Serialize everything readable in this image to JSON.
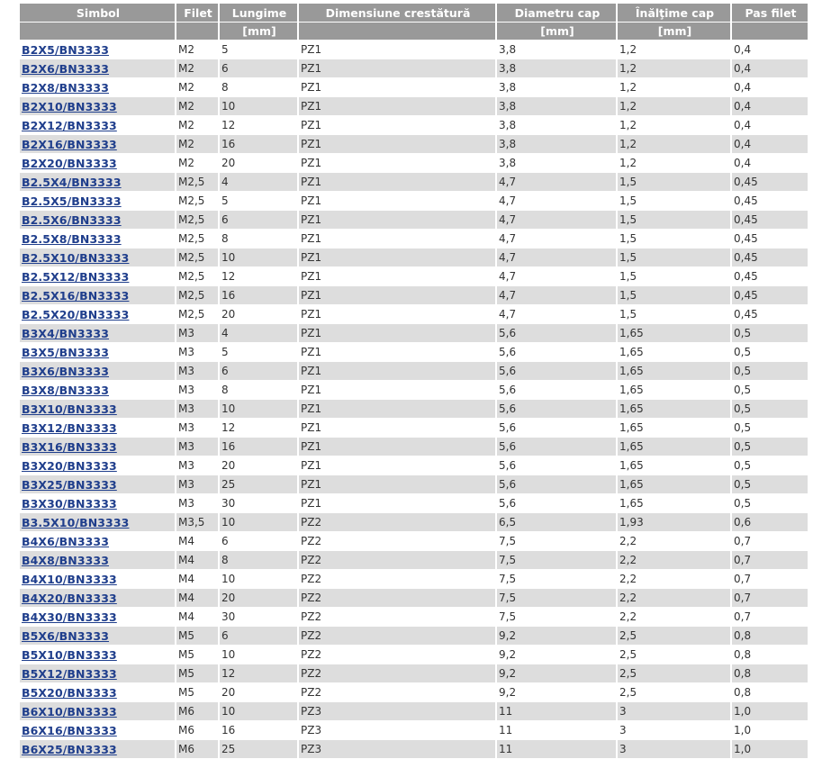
{
  "headers": {
    "simbol": "Simbol",
    "filet": "Filet",
    "lungime": "Lungime",
    "dimensiune": "Dimensiune crestătură",
    "diametru": "Diametru cap",
    "inaltime": "Înălţime cap",
    "pas": "Pas filet"
  },
  "units": {
    "simbol": "",
    "filet": "",
    "lungime": "[mm]",
    "dimensiune": "",
    "diametru": "[mm]",
    "inaltime": "[mm]",
    "pas": ""
  },
  "rows": [
    {
      "simbol": "B2X5/BN3333",
      "filet": "M2",
      "lungime": "5",
      "dimensiune": "PZ1",
      "diametru": "3,8",
      "inaltime": "1,2",
      "pas": "0,4"
    },
    {
      "simbol": "B2X6/BN3333",
      "filet": "M2",
      "lungime": "6",
      "dimensiune": "PZ1",
      "diametru": "3,8",
      "inaltime": "1,2",
      "pas": "0,4"
    },
    {
      "simbol": "B2X8/BN3333",
      "filet": "M2",
      "lungime": "8",
      "dimensiune": "PZ1",
      "diametru": "3,8",
      "inaltime": "1,2",
      "pas": "0,4"
    },
    {
      "simbol": "B2X10/BN3333",
      "filet": "M2",
      "lungime": "10",
      "dimensiune": "PZ1",
      "diametru": "3,8",
      "inaltime": "1,2",
      "pas": "0,4"
    },
    {
      "simbol": "B2X12/BN3333",
      "filet": "M2",
      "lungime": "12",
      "dimensiune": "PZ1",
      "diametru": "3,8",
      "inaltime": "1,2",
      "pas": "0,4"
    },
    {
      "simbol": "B2X16/BN3333",
      "filet": "M2",
      "lungime": "16",
      "dimensiune": "PZ1",
      "diametru": "3,8",
      "inaltime": "1,2",
      "pas": "0,4"
    },
    {
      "simbol": "B2X20/BN3333",
      "filet": "M2",
      "lungime": "20",
      "dimensiune": "PZ1",
      "diametru": "3,8",
      "inaltime": "1,2",
      "pas": "0,4"
    },
    {
      "simbol": "B2.5X4/BN3333",
      "filet": "M2,5",
      "lungime": "4",
      "dimensiune": "PZ1",
      "diametru": "4,7",
      "inaltime": "1,5",
      "pas": "0,45"
    },
    {
      "simbol": "B2.5X5/BN3333",
      "filet": "M2,5",
      "lungime": "5",
      "dimensiune": "PZ1",
      "diametru": "4,7",
      "inaltime": "1,5",
      "pas": "0,45"
    },
    {
      "simbol": "B2.5X6/BN3333",
      "filet": "M2,5",
      "lungime": "6",
      "dimensiune": "PZ1",
      "diametru": "4,7",
      "inaltime": "1,5",
      "pas": "0,45"
    },
    {
      "simbol": "B2.5X8/BN3333",
      "filet": "M2,5",
      "lungime": "8",
      "dimensiune": "PZ1",
      "diametru": "4,7",
      "inaltime": "1,5",
      "pas": "0,45"
    },
    {
      "simbol": "B2.5X10/BN3333",
      "filet": "M2,5",
      "lungime": "10",
      "dimensiune": "PZ1",
      "diametru": "4,7",
      "inaltime": "1,5",
      "pas": "0,45"
    },
    {
      "simbol": "B2.5X12/BN3333",
      "filet": "M2,5",
      "lungime": "12",
      "dimensiune": "PZ1",
      "diametru": "4,7",
      "inaltime": "1,5",
      "pas": "0,45"
    },
    {
      "simbol": "B2.5X16/BN3333",
      "filet": "M2,5",
      "lungime": "16",
      "dimensiune": "PZ1",
      "diametru": "4,7",
      "inaltime": "1,5",
      "pas": "0,45"
    },
    {
      "simbol": "B2.5X20/BN3333",
      "filet": "M2,5",
      "lungime": "20",
      "dimensiune": "PZ1",
      "diametru": "4,7",
      "inaltime": "1,5",
      "pas": "0,45"
    },
    {
      "simbol": "B3X4/BN3333",
      "filet": "M3",
      "lungime": "4",
      "dimensiune": "PZ1",
      "diametru": "5,6",
      "inaltime": "1,65",
      "pas": "0,5"
    },
    {
      "simbol": "B3X5/BN3333",
      "filet": "M3",
      "lungime": "5",
      "dimensiune": "PZ1",
      "diametru": "5,6",
      "inaltime": "1,65",
      "pas": "0,5"
    },
    {
      "simbol": "B3X6/BN3333",
      "filet": "M3",
      "lungime": "6",
      "dimensiune": "PZ1",
      "diametru": "5,6",
      "inaltime": "1,65",
      "pas": "0,5"
    },
    {
      "simbol": "B3X8/BN3333",
      "filet": "M3",
      "lungime": "8",
      "dimensiune": "PZ1",
      "diametru": "5,6",
      "inaltime": "1,65",
      "pas": "0,5"
    },
    {
      "simbol": "B3X10/BN3333",
      "filet": "M3",
      "lungime": "10",
      "dimensiune": "PZ1",
      "diametru": "5,6",
      "inaltime": "1,65",
      "pas": "0,5"
    },
    {
      "simbol": "B3X12/BN3333",
      "filet": "M3",
      "lungime": "12",
      "dimensiune": "PZ1",
      "diametru": "5,6",
      "inaltime": "1,65",
      "pas": "0,5"
    },
    {
      "simbol": "B3X16/BN3333",
      "filet": "M3",
      "lungime": "16",
      "dimensiune": "PZ1",
      "diametru": "5,6",
      "inaltime": "1,65",
      "pas": "0,5"
    },
    {
      "simbol": "B3X20/BN3333",
      "filet": "M3",
      "lungime": "20",
      "dimensiune": "PZ1",
      "diametru": "5,6",
      "inaltime": "1,65",
      "pas": "0,5"
    },
    {
      "simbol": "B3X25/BN3333",
      "filet": "M3",
      "lungime": "25",
      "dimensiune": "PZ1",
      "diametru": "5,6",
      "inaltime": "1,65",
      "pas": "0,5"
    },
    {
      "simbol": "B3X30/BN3333",
      "filet": "M3",
      "lungime": "30",
      "dimensiune": "PZ1",
      "diametru": "5,6",
      "inaltime": "1,65",
      "pas": "0,5"
    },
    {
      "simbol": "B3.5X10/BN3333",
      "filet": "M3,5",
      "lungime": "10",
      "dimensiune": "PZ2",
      "diametru": "6,5",
      "inaltime": "1,93",
      "pas": "0,6"
    },
    {
      "simbol": "B4X6/BN3333",
      "filet": "M4",
      "lungime": "6",
      "dimensiune": "PZ2",
      "diametru": "7,5",
      "inaltime": "2,2",
      "pas": "0,7"
    },
    {
      "simbol": "B4X8/BN3333",
      "filet": "M4",
      "lungime": "8",
      "dimensiune": "PZ2",
      "diametru": "7,5",
      "inaltime": "2,2",
      "pas": "0,7"
    },
    {
      "simbol": "B4X10/BN3333",
      "filet": "M4",
      "lungime": "10",
      "dimensiune": "PZ2",
      "diametru": "7,5",
      "inaltime": "2,2",
      "pas": "0,7"
    },
    {
      "simbol": "B4X20/BN3333",
      "filet": "M4",
      "lungime": "20",
      "dimensiune": "PZ2",
      "diametru": "7,5",
      "inaltime": "2,2",
      "pas": "0,7"
    },
    {
      "simbol": "B4X30/BN3333",
      "filet": "M4",
      "lungime": "30",
      "dimensiune": "PZ2",
      "diametru": "7,5",
      "inaltime": "2,2",
      "pas": "0,7"
    },
    {
      "simbol": "B5X6/BN3333",
      "filet": "M5",
      "lungime": "6",
      "dimensiune": "PZ2",
      "diametru": "9,2",
      "inaltime": "2,5",
      "pas": "0,8"
    },
    {
      "simbol": "B5X10/BN3333",
      "filet": "M5",
      "lungime": "10",
      "dimensiune": "PZ2",
      "diametru": "9,2",
      "inaltime": "2,5",
      "pas": "0,8"
    },
    {
      "simbol": "B5X12/BN3333",
      "filet": "M5",
      "lungime": "12",
      "dimensiune": "PZ2",
      "diametru": "9,2",
      "inaltime": "2,5",
      "pas": "0,8"
    },
    {
      "simbol": "B5X20/BN3333",
      "filet": "M5",
      "lungime": "20",
      "dimensiune": "PZ2",
      "diametru": "9,2",
      "inaltime": "2,5",
      "pas": "0,8"
    },
    {
      "simbol": "B6X10/BN3333",
      "filet": "M6",
      "lungime": "10",
      "dimensiune": "PZ3",
      "diametru": "11",
      "inaltime": "3",
      "pas": "1,0"
    },
    {
      "simbol": "B6X16/BN3333",
      "filet": "M6",
      "lungime": "16",
      "dimensiune": "PZ3",
      "diametru": "11",
      "inaltime": "3",
      "pas": "1,0"
    },
    {
      "simbol": "B6X25/BN3333",
      "filet": "M6",
      "lungime": "25",
      "dimensiune": "PZ3",
      "diametru": "11",
      "inaltime": "3",
      "pas": "1,0"
    }
  ]
}
